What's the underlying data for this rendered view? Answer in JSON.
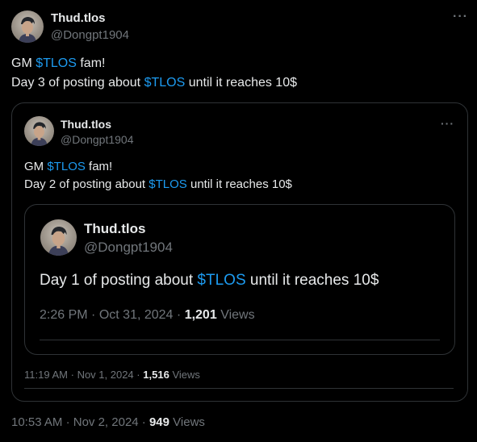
{
  "tweet": {
    "author_name": "Thud.tlos",
    "author_handle": "@Dongpt1904",
    "more_icon": "more-horizontal-icon",
    "line1": {
      "pre": "GM ",
      "tag": "$TLOS",
      "post": " fam!"
    },
    "line2": {
      "pre": "Day 3 of posting about ",
      "tag": "$TLOS",
      "post": " until it reaches 10$"
    },
    "time": "10:53 AM",
    "date": "Nov 2, 2024",
    "views_count": "949",
    "views_label": "Views"
  },
  "quote1": {
    "author_name": "Thud.tlos",
    "author_handle": "@Dongpt1904",
    "more_icon": "more-horizontal-icon",
    "line1": {
      "pre": "GM ",
      "tag": "$TLOS",
      "post": " fam!"
    },
    "line2": {
      "pre": "Day 2 of posting about ",
      "tag": "$TLOS",
      "post": " until it reaches 10$"
    },
    "time": "11:19 AM",
    "date": "Nov 1, 2024",
    "views_count": "1,516",
    "views_label": "Views"
  },
  "quote2": {
    "author_name": "Thud.tlos",
    "author_handle": "@Dongpt1904",
    "line1": {
      "pre": "Day 1 of posting about ",
      "tag": "$TLOS",
      "post": " until it reaches 10$"
    },
    "time": "2:26 PM",
    "date": "Oct 31, 2024",
    "views_count": "1,201",
    "views_label": "Views"
  },
  "sep": "·",
  "colors": {
    "background": "#000000",
    "text": "#e7e9ea",
    "secondary": "#71767b",
    "accent": "#1d9bf0",
    "border": "#2f3336"
  }
}
